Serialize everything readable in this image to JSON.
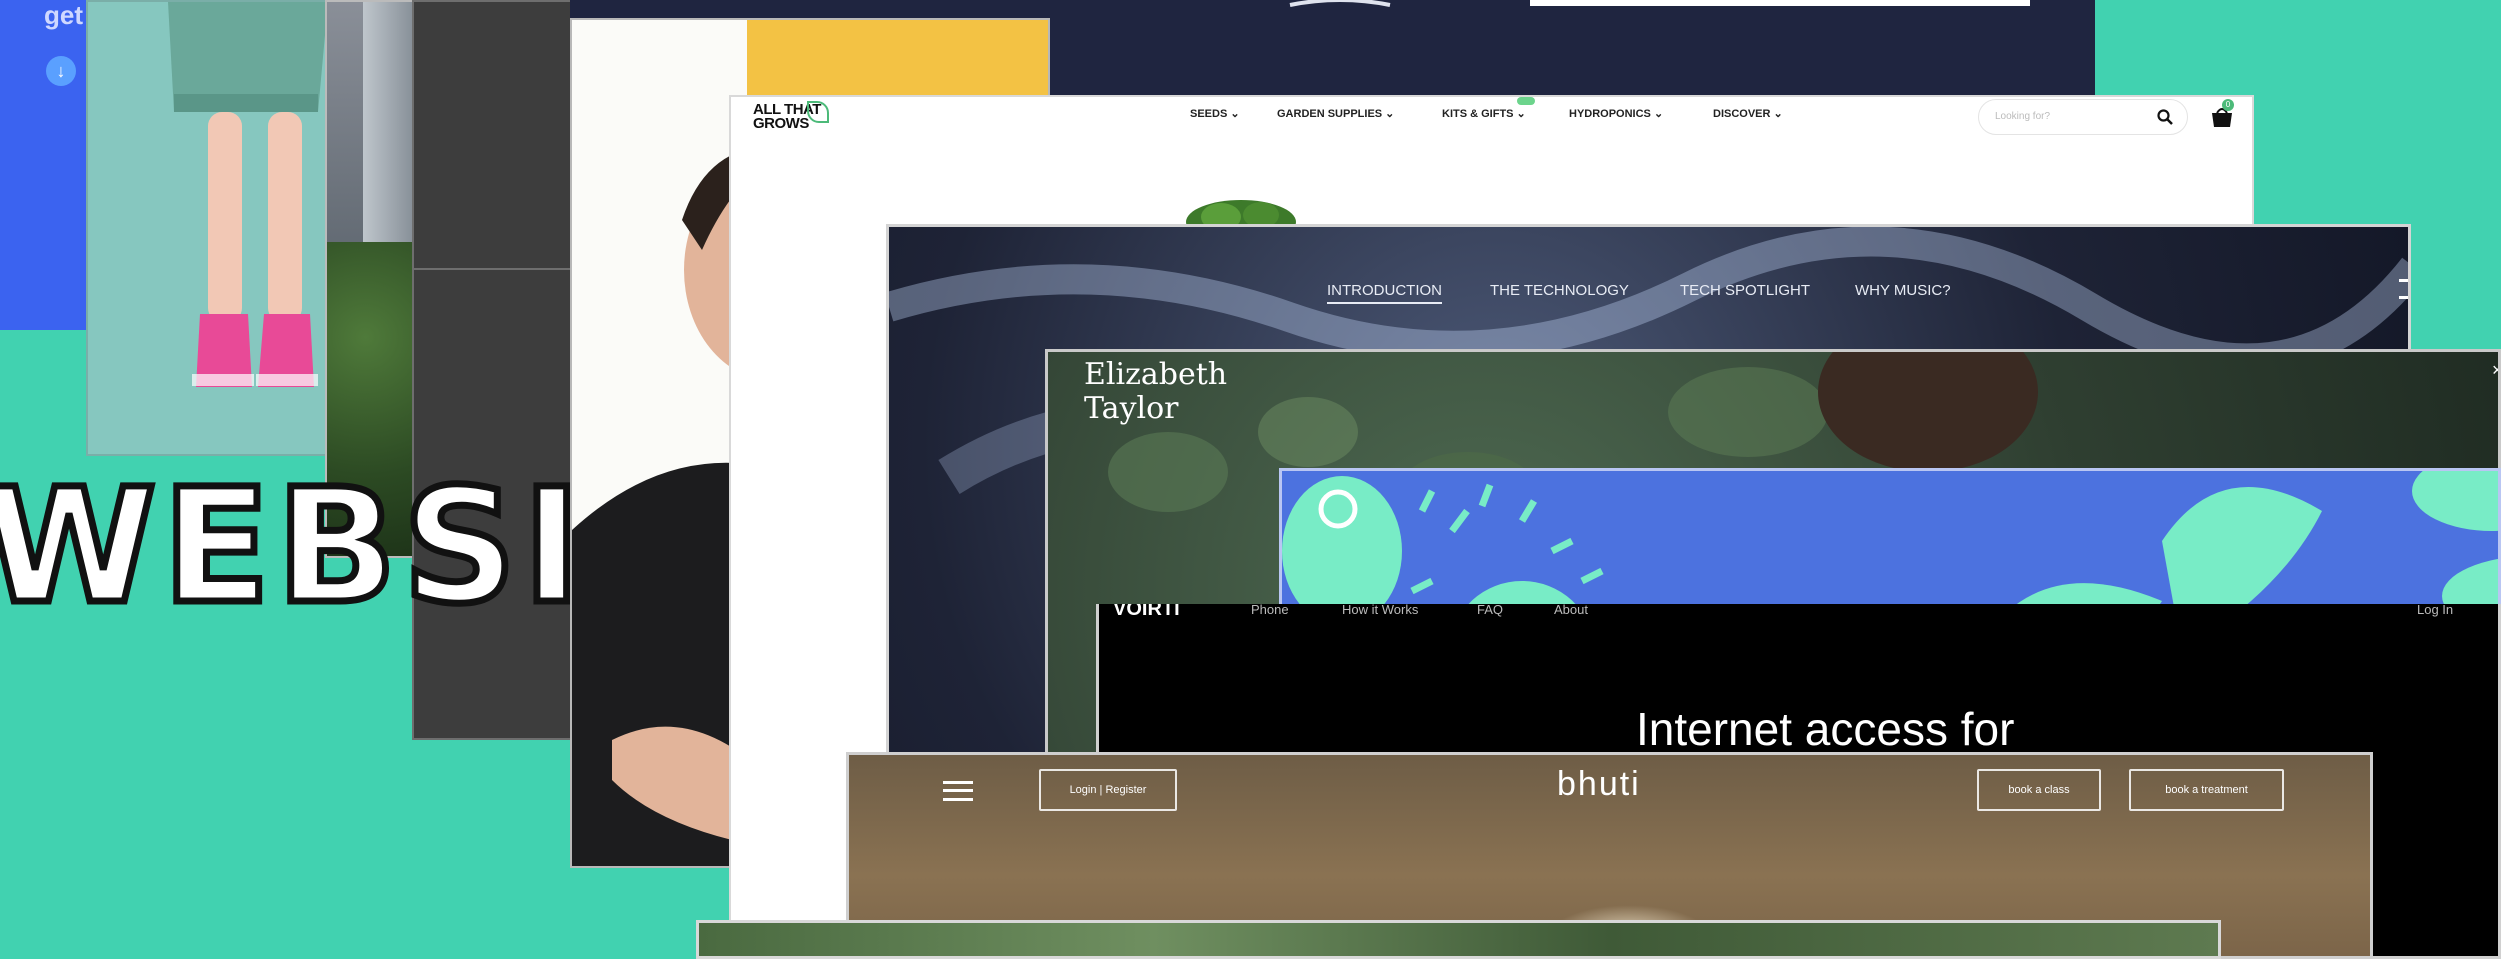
{
  "headline": {
    "word": "WEBSI",
    "corner_text": "get"
  },
  "nav_garden": {
    "logo": "ALL THAT GROWS",
    "items": [
      "SEEDS ⌄",
      "GARDEN SUPPLIES ⌄",
      "KITS & GIFTS ⌄",
      "HYDROPONICS ⌄",
      "DISCOVER ⌄"
    ],
    "search_placeholder": "Looking for?",
    "badge": "0"
  },
  "nav_music": {
    "items": [
      "INTRODUCTION",
      "THE TECHNOLOGY",
      "TECH SPOTLIGHT",
      "WHY MUSIC?"
    ]
  },
  "liz": {
    "name": "Elizabeth Taylor"
  },
  "voirti": {
    "logo": "VOIRTI",
    "items": [
      "Phone",
      "How it Works",
      "FAQ",
      "About"
    ],
    "login": "Log In",
    "headline": "Internet access for"
  },
  "bhuti": {
    "login": "Login | Register",
    "logo": "bhuti",
    "book_class": "book a class",
    "book_treatment": "book a treatment"
  },
  "colors": {
    "teal": "#41d2b0",
    "blue": "#3b63f0",
    "navy": "#1f2540",
    "yellow": "#f3c244",
    "mint": "#78ecc6",
    "periwinkle": "#4c72df"
  }
}
